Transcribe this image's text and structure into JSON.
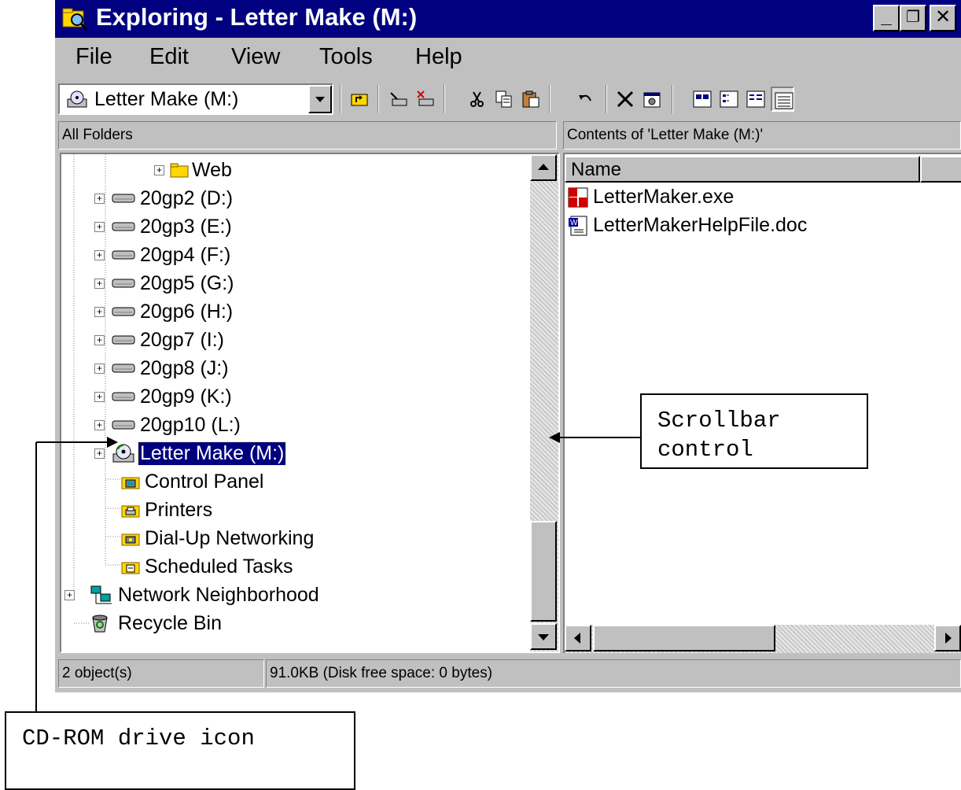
{
  "window": {
    "title": "Exploring - Letter Make (M:)",
    "controls": {
      "minimize": "_",
      "maximize": "❐",
      "close": "✕"
    }
  },
  "menu": [
    "File",
    "Edit",
    "View",
    "Tools",
    "Help"
  ],
  "toolbar": {
    "address": "Letter Make (M:)",
    "buttons": [
      "up-one-level-icon",
      "map-network-drive-icon",
      "disconnect-drive-icon",
      "cut-icon",
      "copy-icon",
      "paste-icon",
      "undo-icon",
      "delete-icon",
      "properties-icon",
      "large-icons-view-icon",
      "small-icons-view-icon",
      "list-view-icon",
      "details-view-icon"
    ]
  },
  "left_pane": {
    "header": "All Folders",
    "tree": [
      {
        "label": "Web",
        "icon": "folder-icon",
        "expandable": true
      },
      {
        "label": "20gp2 (D:)",
        "icon": "network-drive-icon",
        "expandable": true
      },
      {
        "label": "20gp3 (E:)",
        "icon": "network-drive-icon",
        "expandable": true
      },
      {
        "label": "20gp4 (F:)",
        "icon": "network-drive-icon",
        "expandable": true
      },
      {
        "label": "20gp5 (G:)",
        "icon": "network-drive-icon",
        "expandable": true
      },
      {
        "label": "20gp6 (H:)",
        "icon": "network-drive-icon",
        "expandable": true
      },
      {
        "label": "20gp7 (I:)",
        "icon": "network-drive-icon",
        "expandable": true
      },
      {
        "label": "20gp8 (J:)",
        "icon": "network-drive-icon",
        "expandable": true
      },
      {
        "label": "20gp9 (K:)",
        "icon": "network-drive-icon",
        "expandable": true
      },
      {
        "label": "20gp10 (L:)",
        "icon": "network-drive-icon",
        "expandable": true
      },
      {
        "label": "Letter Make (M:)",
        "icon": "cd-rom-drive-icon",
        "expandable": true,
        "selected": true
      },
      {
        "label": "Control Panel",
        "icon": "control-panel-icon",
        "expandable": false
      },
      {
        "label": "Printers",
        "icon": "printers-icon",
        "expandable": false
      },
      {
        "label": "Dial-Up Networking",
        "icon": "dial-up-networking-icon",
        "expandable": false
      },
      {
        "label": "Scheduled Tasks",
        "icon": "scheduled-tasks-icon",
        "expandable": false
      },
      {
        "label": "Network Neighborhood",
        "icon": "network-neighborhood-icon",
        "expandable": true
      },
      {
        "label": "Recycle Bin",
        "icon": "recycle-bin-icon",
        "expandable": false
      }
    ]
  },
  "right_pane": {
    "header": "Contents of 'Letter Make (M:)'",
    "column": "Name",
    "files": [
      {
        "name": "LetterMaker.exe",
        "icon": "exe-icon"
      },
      {
        "name": "LetterMakerHelpFile.doc",
        "icon": "word-doc-icon"
      }
    ]
  },
  "status": {
    "objects": "2 object(s)",
    "size": "91.0KB (Disk free space: 0 bytes)"
  },
  "annotations": {
    "scrollbar": [
      "Scrollbar",
      "control"
    ],
    "cdrom": "CD-ROM drive icon"
  },
  "colors": {
    "titlebar": "#000080",
    "chrome": "#c0c0c0",
    "selection": "#000080"
  }
}
